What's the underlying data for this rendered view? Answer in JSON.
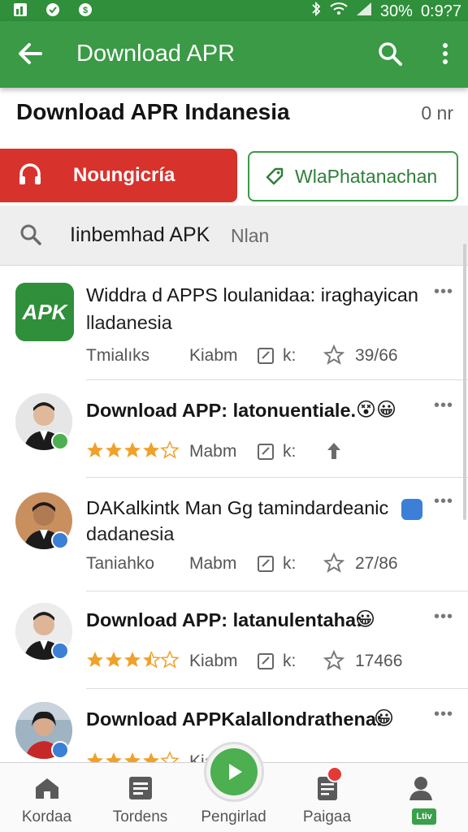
{
  "status_bar": {
    "battery_pct": "30%",
    "time": "0:9?7",
    "icons": [
      "app-icon",
      "shield-icon",
      "money-icon",
      "bluetooth-icon",
      "wifi-icon",
      "signal-icon"
    ]
  },
  "app_bar": {
    "title": "Download APR",
    "back_icon": "arrow-left-icon",
    "search_icon": "search-icon",
    "more_icon": "more-vert-icon"
  },
  "header": {
    "title": "Download APR Indanesia",
    "meta": "0 nr"
  },
  "actions": {
    "primary_label": "Noungicría",
    "primary_icon": "headset-icon",
    "secondary_label": "WlaPhatanachan",
    "secondary_icon": "tag-icon"
  },
  "search": {
    "query": "Iinbemhad APK",
    "sub": "Nlan",
    "icon": "search-icon"
  },
  "list": [
    {
      "title_line1": "Widdra d APPS loulanidaa: iraghayican",
      "title_line2": "lladanesia",
      "meta_left": "Tmialıks",
      "meta_mid": "Kiabm",
      "meta_k": "k:",
      "meta_right": "39/66",
      "avatar_kind": "apk-logo",
      "apk_label": "APK"
    },
    {
      "title_line1": "Download APP: latonuentiale.",
      "rating": 4,
      "meta_mid": "Mabm",
      "meta_k": "k:",
      "avatar_kind": "person",
      "emoji": [
        "😵",
        "😀"
      ]
    },
    {
      "title_line1": "DAKalkintk Man Gg tamindardeanic",
      "title_line2": "dadanesia",
      "meta_left": "Taniahko",
      "meta_mid": "Mabm",
      "meta_k": "k:",
      "meta_right": "27/86",
      "avatar_kind": "person"
    },
    {
      "title_line1": "Download APP: latanulentaha:",
      "rating": 3.5,
      "meta_mid": "Kiabm",
      "meta_k": "k:",
      "meta_right": "17466",
      "avatar_kind": "person",
      "emoji": [
        "😀"
      ]
    },
    {
      "title_line1": "Download APPKalallondrathena:",
      "rating": 4,
      "meta_mid": "Kiabm",
      "avatar_kind": "person",
      "emoji": [
        "😀"
      ]
    }
  ],
  "bottom_nav": [
    {
      "label": "Kordaa",
      "icon": "home-icon"
    },
    {
      "label": "Tordens",
      "icon": "list-icon"
    },
    {
      "label": "Pengirlad",
      "icon": "play-icon"
    },
    {
      "label": "Paigaa",
      "icon": "document-icon"
    },
    {
      "label": "",
      "icon": "profile-icon",
      "tag": "Ltiv"
    }
  ],
  "colors": {
    "app_bar": "#3a9a46",
    "primary_red": "#d8322c",
    "accent_green": "#2f8f3a",
    "star": "#f0a12a"
  }
}
